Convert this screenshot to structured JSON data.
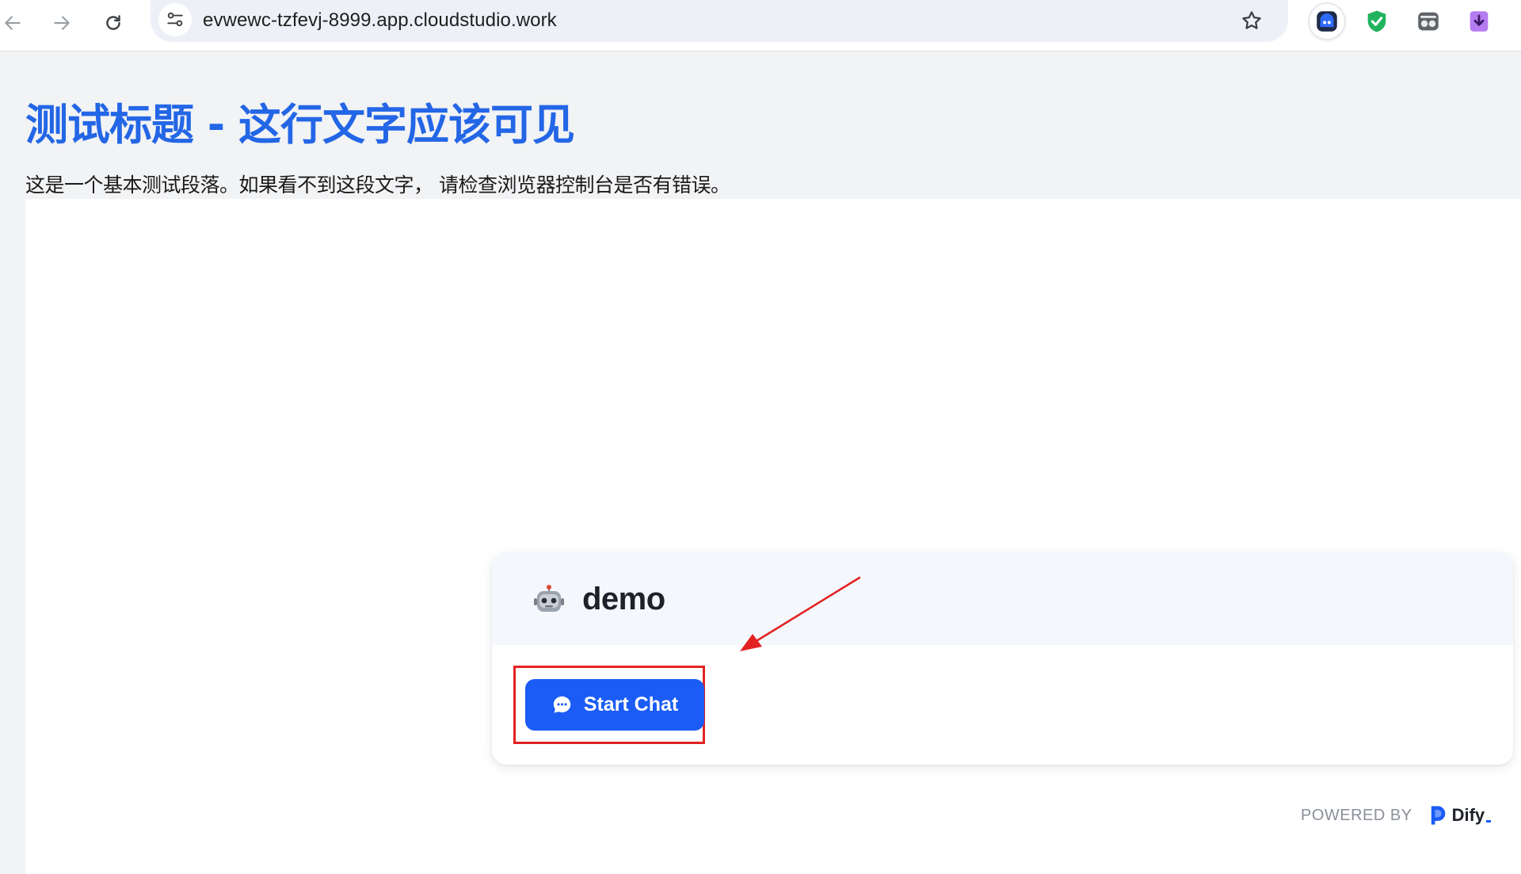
{
  "browser": {
    "url": "evwewc-tzfevj-8999.app.cloudstudio.work",
    "icons": {
      "back": "arrow-left-icon",
      "forward": "arrow-right-icon",
      "reload": "reload-icon",
      "site_info": "tune-icon",
      "bookmark": "star-icon"
    },
    "extensions": [
      "ghost-extension-icon",
      "shield-check-extension-icon",
      "incognito-extension-icon",
      "download-extension-icon"
    ]
  },
  "page": {
    "title": "测试标题 - 这行文字应该可见",
    "paragraph": "这是一个基本测试段落。如果看不到这段文字， 请检查浏览器控制台是否有错误。"
  },
  "card": {
    "icon": "robot-icon",
    "app_name": "demo",
    "start_button_label": "Start Chat",
    "start_button_icon": "chat-bubble-icon"
  },
  "footer": {
    "powered_by": "POWERED BY",
    "brand": "Dify"
  },
  "colors": {
    "accent": "#1a5cf5",
    "title": "#2366e6",
    "annotation": "#e32222"
  }
}
